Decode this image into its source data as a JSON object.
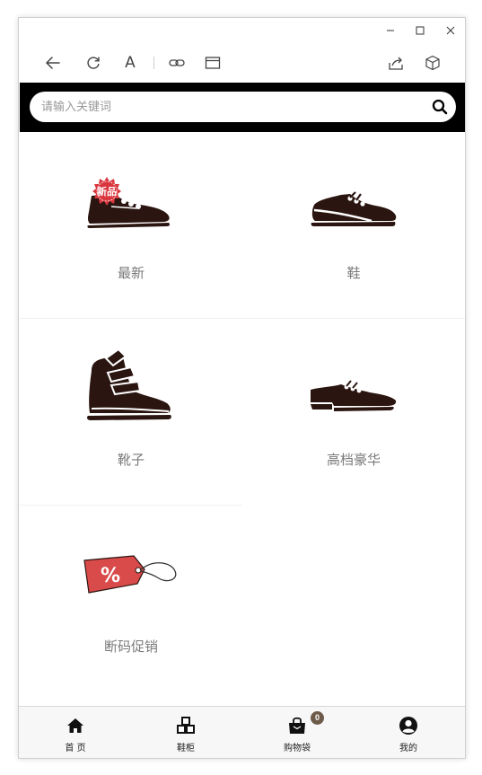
{
  "window": {
    "controls": {
      "minimize_glyph": "—",
      "maximize_glyph": "☐",
      "close_glyph": "✕"
    }
  },
  "toolbar": {
    "icons": [
      "back-arrow-icon",
      "refresh-icon",
      "text-size-icon",
      "link-icon",
      "window-icon",
      "share-icon",
      "cube-icon"
    ],
    "text_icon_glyph": "A"
  },
  "search": {
    "placeholder": "请输入关键词",
    "value": ""
  },
  "categories": [
    {
      "label": "最新",
      "icon": "new-shoe-icon",
      "badge": "新品"
    },
    {
      "label": "鞋",
      "icon": "sneaker-icon"
    },
    {
      "label": "靴子",
      "icon": "boot-icon"
    },
    {
      "label": "高档豪华",
      "icon": "dress-shoe-icon"
    },
    {
      "label": "断码促销",
      "icon": "discount-tag-icon",
      "tag_text": "%"
    }
  ],
  "tabbar": {
    "tabs": [
      {
        "label": "首 页",
        "icon": "home-icon"
      },
      {
        "label": "鞋柜",
        "icon": "boxes-icon"
      },
      {
        "label": "购物袋",
        "icon": "shopping-bag-icon"
      },
      {
        "label": "我的",
        "icon": "user-icon"
      }
    ],
    "cart_count": "0"
  },
  "colors": {
    "shoe": "#2a1510",
    "tag": "#d94a4a",
    "badge": "#6d5a49",
    "searchbar": "#000000",
    "label": "#7a7a7a"
  }
}
